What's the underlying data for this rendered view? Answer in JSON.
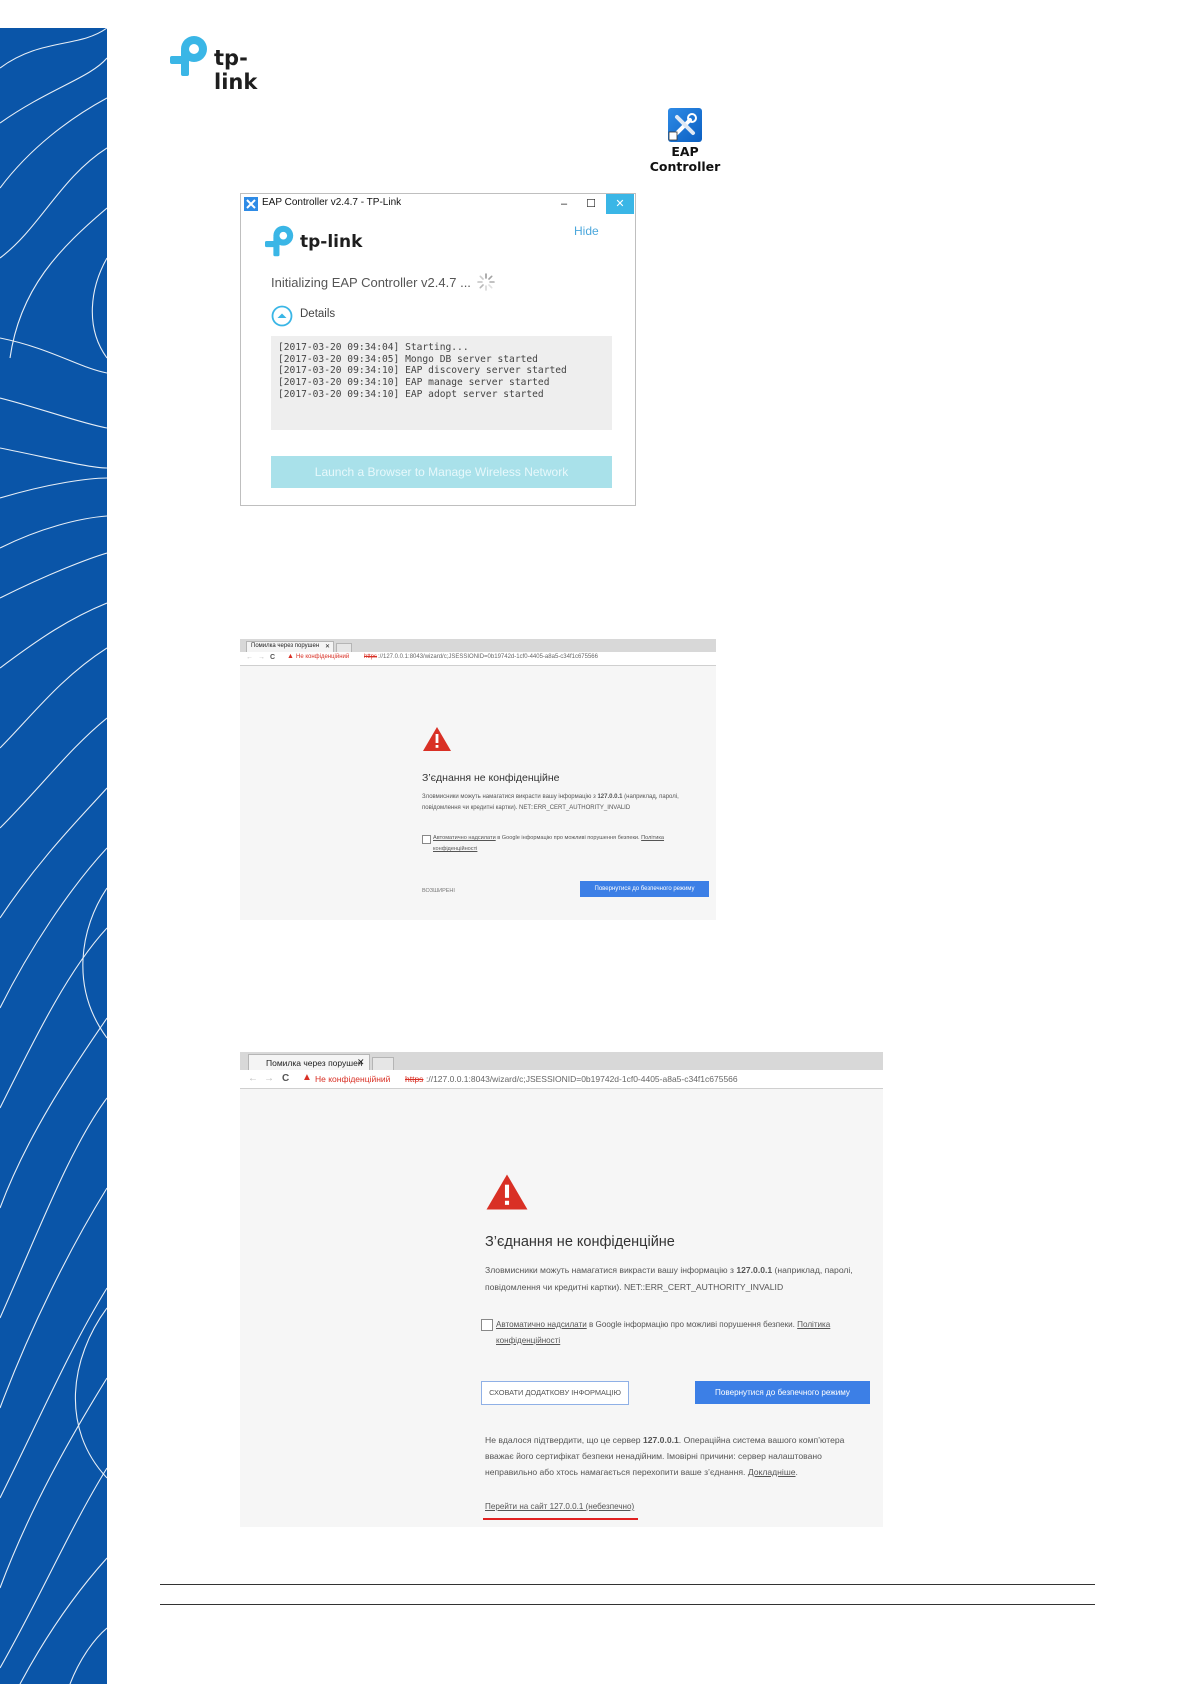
{
  "brand": {
    "logo_text": "tp-link"
  },
  "desktop_shortcut": {
    "label": "EAP Controller",
    "icon": "wrench-screwdriver-icon"
  },
  "eap_window": {
    "title": "EAP Controller v2.4.7 - TP-Link",
    "minimize": "–",
    "maximize": "☐",
    "close": "✕",
    "logo_text": "tp-link",
    "hide_label": "Hide",
    "status_text": "Initializing EAP Controller v2.4.7 ...",
    "details_label": "Details",
    "log_lines": [
      "[2017-03-20 09:34:04] Starting...",
      "[2017-03-20 09:34:05] Mongo DB server started",
      "[2017-03-20 09:34:10] EAP discovery server started",
      "[2017-03-20 09:34:10] EAP manage server started",
      "[2017-03-20 09:34:10] EAP adopt server started"
    ],
    "launch_button": "Launch a Browser to Manage Wireless Network"
  },
  "browser": {
    "tab_title": "Помилка через порушен",
    "tab_close": "✕",
    "nav_back": "←",
    "nav_forward": "→",
    "nav_reload": "C",
    "not_secure_label": "Не конфіденційний",
    "url_scheme": "https",
    "url_rest": "://127.0.0.1:8043/wizard/c;JSESSIONID=0b19742d-1cf0-4405-a8a5-c34f1c675566",
    "heading": "З’єднання не конфіденційне",
    "body_1": "Зловмисники можуть намагатися викрасти вашу інформацію з ",
    "body_host": "127.0.0.1",
    "body_2": " (наприклад, паролі, повідомлення чи кредитні картки). NET::ERR_CERT_AUTHORITY_INVALID",
    "checkbox_link": "Автоматично надсилати",
    "checkbox_text": " в Google інформацію про можливі порушення безпеки. ",
    "privacy_link": "Політика конфіденційності",
    "advanced_label": "ВОЗШИРЕНІ",
    "hide_details_button": "СХОВАТИ ДОДАТКОВУ ІНФОРМАЦІЮ",
    "back_to_safety_button": "Повернутися до безпечного режиму",
    "detail_1": "Не вдалося підтвердити, що це сервер ",
    "detail_host": "127.0.0.1",
    "detail_2": ". Операційна система вашого комп’ютера вважає його сертифікат безпеки ненадійним. Імовірні причини: сервер налаштовано неправильно або хтось намагається перехопити ваше з’єднання. ",
    "learn_more": "Докладніше",
    "proceed_link": "Перейти на сайт 127.0.0.1 (небезпечно)"
  },
  "colors": {
    "brand_blue": "#0a55a8",
    "accent_cyan": "#3ab6e6",
    "chrome_blue": "#3c7fe6",
    "warning_red": "#d93025"
  }
}
